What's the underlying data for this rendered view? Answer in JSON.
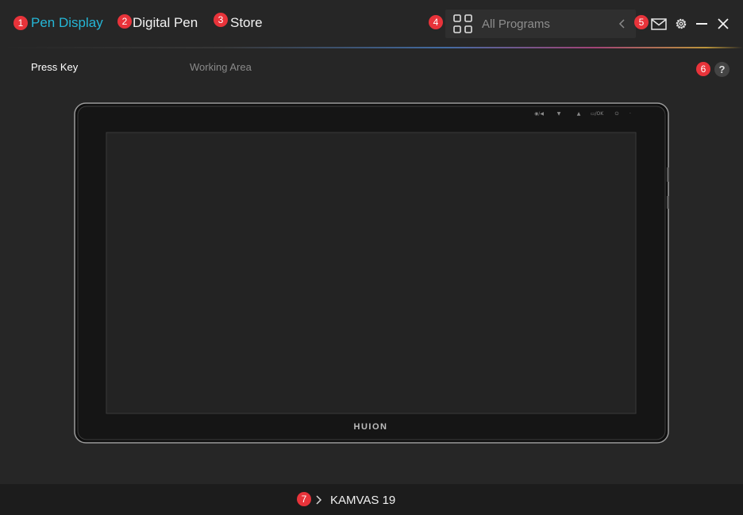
{
  "header": {
    "tabs": [
      {
        "badge": "1",
        "label": "Pen Display"
      },
      {
        "badge": "2",
        "label": "Digital Pen"
      },
      {
        "badge": "3",
        "label": "Store"
      }
    ],
    "programs": {
      "badge": "4",
      "label": "All Programs"
    },
    "actions_badge": "5"
  },
  "subtabs": {
    "items": [
      "Press Key",
      "Working Area"
    ],
    "help_badge": "6",
    "help_symbol": "?"
  },
  "device": {
    "brand": "HUION",
    "top_buttons": [
      "◉/◀",
      "▼",
      "▲",
      "▭/OK",
      "⏻",
      "·"
    ]
  },
  "footer": {
    "badge": "7",
    "device_name": "KAMVAS 19"
  },
  "colors": {
    "accent": "#25b6d6",
    "badge": "#e8333a",
    "background": "#262626"
  }
}
